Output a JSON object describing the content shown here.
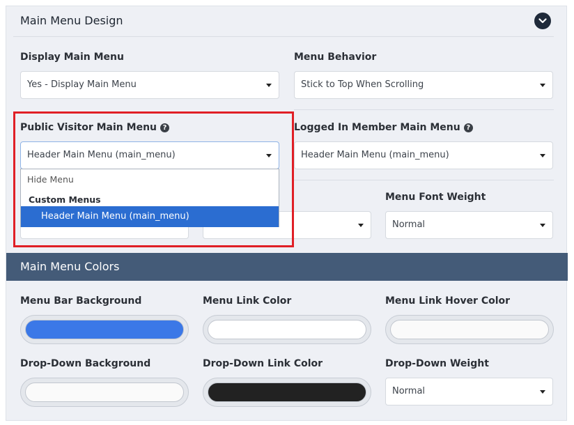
{
  "design": {
    "title": "Main Menu Design"
  },
  "fields": {
    "display_main_menu": {
      "label": "Display Main Menu",
      "value": "Yes - Display Main Menu"
    },
    "menu_behavior": {
      "label": "Menu Behavior",
      "value": "Stick to Top When Scrolling"
    },
    "public_visitor_menu": {
      "label": "Public Visitor Main Menu",
      "value": "Header Main Menu (main_menu)"
    },
    "logged_in_menu": {
      "label": "Logged In Member Main Menu",
      "value": "Header Main Menu (main_menu)"
    },
    "menu_font_weight": {
      "label": "Menu Font Weight",
      "value": "Normal"
    }
  },
  "dropdown": {
    "options": [
      "Hide Menu"
    ],
    "group_label": "Custom Menus",
    "selected": "Header Main Menu (main_menu)"
  },
  "colors_section": {
    "title": "Main Menu Colors",
    "menu_bar_background": {
      "label": "Menu Bar Background",
      "color": "#3b78e7"
    },
    "menu_link_color": {
      "label": "Menu Link Color",
      "color": "#ffffff"
    },
    "menu_link_hover_color": {
      "label": "Menu Link Hover Color",
      "color": "#fafafa"
    },
    "dropdown_background": {
      "label": "Drop-Down Background",
      "color": "#fafafa"
    },
    "dropdown_link_color": {
      "label": "Drop-Down Link Color",
      "color": "#222222"
    },
    "dropdown_weight": {
      "label": "Drop-Down Weight",
      "value": "Normal"
    }
  },
  "theme": {
    "accent": "#2b6dd1",
    "band": "#445b78",
    "highlight": "#e01f26"
  }
}
